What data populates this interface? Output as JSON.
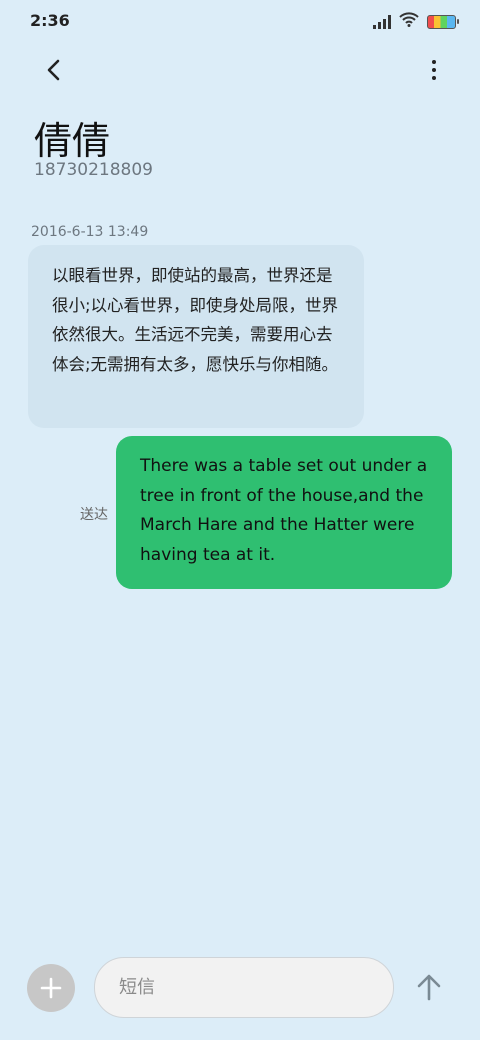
{
  "status_bar": {
    "time": "2:36",
    "icons": [
      "signal-icon",
      "wifi-icon",
      "battery-icon"
    ]
  },
  "header": {
    "back_icon": "chevron-left-icon",
    "more_icon": "more-vertical-icon",
    "contact_name": "倩倩",
    "contact_number": "18730218809"
  },
  "conversation": {
    "timestamp": "2016-6-13 13:49",
    "incoming": {
      "text": "以眼看世界，即使站的最高，世界还是很小;以心看世界，即使身处局限，世界依然很大。生活远不完美，需要用心去体会;无需拥有太多，愿快乐与你相随。"
    },
    "outgoing": {
      "text": "There was a table set out under a tree in front of the house,and the March Hare and the Hatter were having tea at it.",
      "status": "送达"
    }
  },
  "composer": {
    "placeholder": "短信",
    "value": "",
    "add_icon": "plus-icon",
    "send_icon": "arrow-up-icon"
  },
  "colors": {
    "background": "#dcedf8",
    "incoming_bubble": "#d1e4f0",
    "outgoing_bubble": "#2fbf71"
  }
}
